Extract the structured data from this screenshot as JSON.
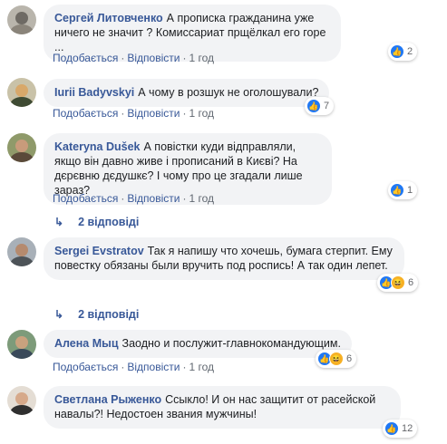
{
  "comments": [
    {
      "author": "Сергей Литовченко",
      "text": "А прописка гражданина уже ничего не значит ? Комиссариат прщёлкал его горе ...",
      "like": "Подобається",
      "reply": "Відповісти",
      "time": "1 год",
      "react_count": "2",
      "reactions": [
        "like"
      ]
    },
    {
      "author": "Iurii Badyvskyi",
      "text": "А чому в розшук не оголошували?",
      "like": "Подобається",
      "reply": "Відповісти",
      "time": "1 год",
      "react_count": "7",
      "reactions": [
        "like"
      ]
    },
    {
      "author": "Kateryna Dušek",
      "text": "А повістки куди відправляли, якщо він давно живе і прописаний в Києві? На дєрєвню дєдушкє? І чому про це згадали лише зараз?",
      "like": "Подобається",
      "reply": "Відповісти",
      "time": "1 год",
      "react_count": "1",
      "reactions": [
        "like"
      ],
      "replies_label": "2 відповіді"
    },
    {
      "author": "Sergei Evstratov",
      "text": "Так я напишу что хочешь, бумага стерпит. Ему повестку обязаны были вручить под роспись! А так один лепет.",
      "react_count": "6",
      "reactions": [
        "like",
        "haha"
      ],
      "replies_label": "2 відповіді"
    },
    {
      "author": "Алена Мыц",
      "text": "Заодно и послужит-главнокомандующим.",
      "like": "Подобається",
      "reply": "Відповісти",
      "time": "1 год",
      "react_count": "6",
      "reactions": [
        "like",
        "haha"
      ]
    },
    {
      "author": "Светлана Рыженко",
      "text": "Ссыкло! И он нас защитит от расейской навалы?! Недостоен звания мужчины!",
      "react_count": "12",
      "reactions": [
        "like"
      ]
    }
  ],
  "icons": {
    "like": "thumbs-up-icon",
    "haha": "laughing-face-icon",
    "reply_arrow": "reply-arrow-icon"
  },
  "colors": {
    "author": "#385898",
    "bubble": "#f2f3f5",
    "like": "#2078f4",
    "haha": "#f7b125"
  }
}
